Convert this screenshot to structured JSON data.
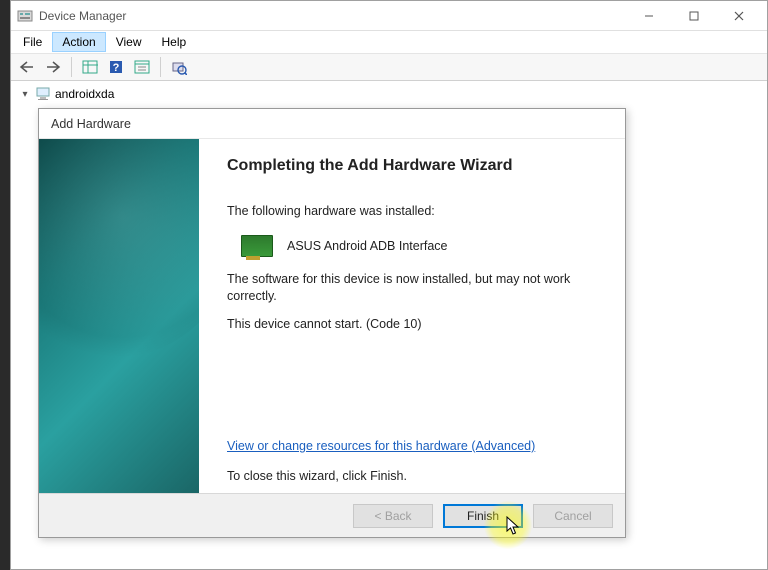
{
  "window": {
    "title": "Device Manager"
  },
  "menu": {
    "file": "File",
    "action": "Action",
    "view": "View",
    "help": "Help"
  },
  "tree": {
    "root": "androidxda"
  },
  "wizard": {
    "title": "Add Hardware",
    "heading": "Completing the Add Hardware Wizard",
    "installed_line": "The following hardware was installed:",
    "device_name": "ASUS Android ADB Interface",
    "status_line1": "The software for this device is now installed, but may not work correctly.",
    "status_line2": "This device cannot start. (Code 10)",
    "link": "View or change resources for this hardware (Advanced)",
    "close_hint": "To close this wizard, click Finish.",
    "buttons": {
      "back": "< Back",
      "finish": "Finish",
      "cancel": "Cancel"
    }
  }
}
